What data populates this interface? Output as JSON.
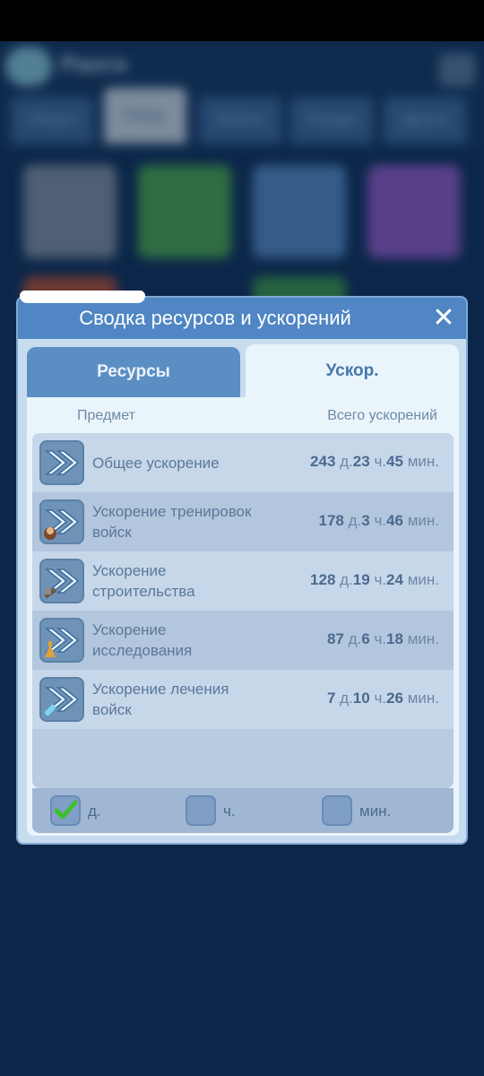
{
  "background": {
    "title": "Ранги",
    "tabs": [
      "Общее",
      "Гильд.",
      "Войска",
      "Отряды",
      "Другое"
    ]
  },
  "dialog": {
    "title": "Сводка ресурсов и ускорений",
    "close_icon": "close-icon",
    "tabs": [
      {
        "label": "Ресурсы",
        "active": false
      },
      {
        "label": "Ускор.",
        "active": true
      }
    ],
    "columns": {
      "item": "Предмет",
      "total": "Всего ускорений"
    },
    "items": [
      {
        "label": "Общее ускорение",
        "icon": "general-speedup-icon",
        "d": "243",
        "d_unit": "д.",
        "h": "23",
        "h_unit": "ч.",
        "m": "45",
        "m_unit": "мин."
      },
      {
        "label": "Ускорение тренировок войск",
        "icon": "training-speedup-icon",
        "d": "178",
        "d_unit": "д.",
        "h": "3",
        "h_unit": "ч.",
        "m": "46",
        "m_unit": "мин."
      },
      {
        "label": "Ускорение строительства",
        "icon": "construction-speedup-icon",
        "d": "128",
        "d_unit": "д.",
        "h": "19",
        "h_unit": "ч.",
        "m": "24",
        "m_unit": "мин."
      },
      {
        "label": "Ускорение исследования",
        "icon": "research-speedup-icon",
        "d": "87",
        "d_unit": "д.",
        "h": "6",
        "h_unit": "ч.",
        "m": "18",
        "m_unit": "мин."
      },
      {
        "label": "Ускорение лечения войск",
        "icon": "healing-speedup-icon",
        "d": "7",
        "d_unit": "д.",
        "h": "10",
        "h_unit": "ч.",
        "m": "26",
        "m_unit": "мин."
      }
    ],
    "filters": [
      {
        "label": "д.",
        "checked": true
      },
      {
        "label": "ч.",
        "checked": false
      },
      {
        "label": "мин.",
        "checked": false
      }
    ],
    "colors": {
      "header": "#4f86c3",
      "panel": "#eaf4fb",
      "check": "#3fbf2f"
    }
  }
}
